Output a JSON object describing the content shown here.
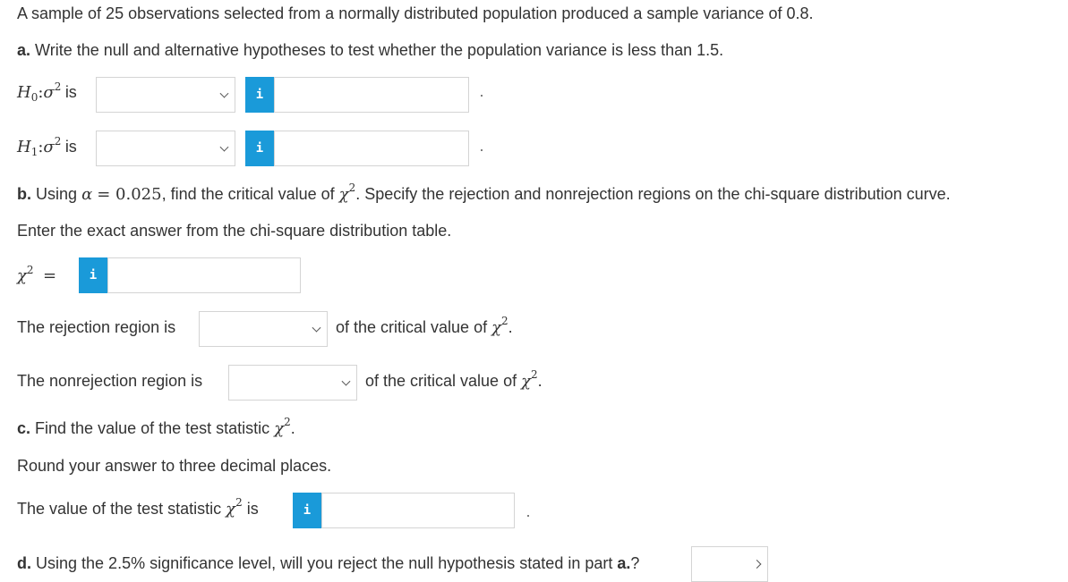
{
  "intro": "A sample of 25 observations selected from a normally distributed population produced a sample variance of 0.8.",
  "part_a": {
    "prefix": "a.",
    "text": "Write the null and alternative hypotheses to test whether the population variance is less than 1.5.",
    "h0_label": "is",
    "h1_label": "is"
  },
  "part_b": {
    "prefix": "b.",
    "using": "Using",
    "alpha_eq": "= 0.025",
    "text_rest": ", find the critical value of",
    "text_tail": ". Specify the rejection and nonrejection regions on the chi-square distribution curve.",
    "instruction": "Enter the exact answer from the chi-square distribution table.",
    "equals": "=",
    "rejection_label": "The rejection region is",
    "nonrejection_label": "The nonrejection region is",
    "of_critical": "of the critical value of"
  },
  "part_c": {
    "prefix": "c.",
    "text": "Find the value of the test statistic",
    "round": "Round your answer to three decimal places.",
    "value_label": "The value of the test statistic",
    "is": "is"
  },
  "part_d": {
    "prefix": "d.",
    "text": "Using the 2.5% significance level, will you reject the null hypothesis stated in part",
    "part_ref": "a.",
    "qmark": "?"
  },
  "symbols": {
    "H": "H",
    "sub0": "0",
    "sub1": "1",
    "sigma": "σ",
    "chi": "χ",
    "two": "2",
    "alpha": "α",
    "colon": ":",
    "period": "."
  },
  "info_glyph": "i",
  "colors": {
    "info_button": "#1a9ad9",
    "border": "#d4d4d4",
    "text": "#333333"
  }
}
